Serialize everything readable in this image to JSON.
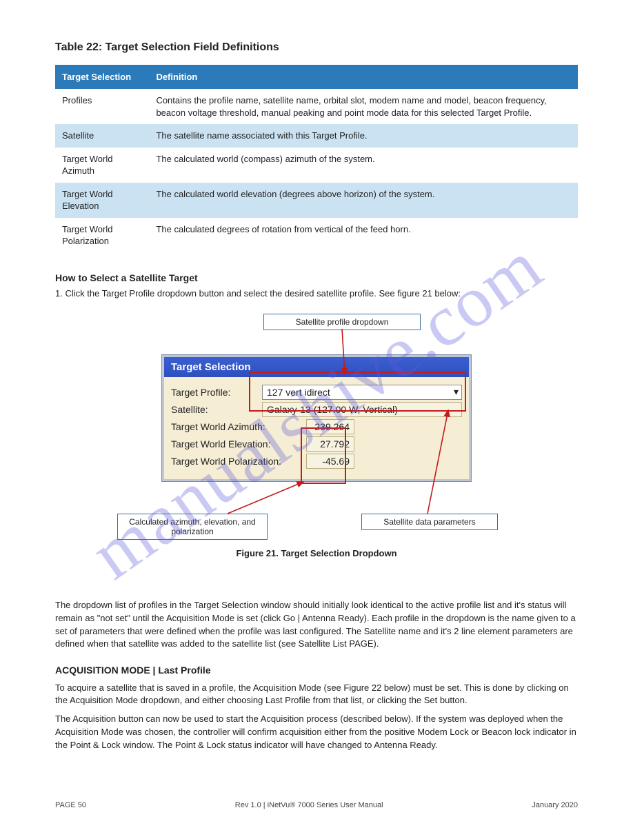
{
  "page": {
    "title": "Table 22: Target Selection Field Definitions",
    "watermark": "manualshive.com"
  },
  "table": {
    "head": {
      "col0": "Target Selection",
      "col1": "Definition"
    },
    "rows": [
      {
        "label": "Profiles",
        "text": "Contains the profile name, satellite name, orbital slot, modem name and model, beacon frequency, beacon voltage threshold, manual peaking and point mode data for this selected Target Profile."
      },
      {
        "label": "Satellite",
        "text": "The satellite name associated with this Target Profile."
      },
      {
        "label": "Target World Azimuth",
        "text": "The calculated world (compass) azimuth of the system."
      },
      {
        "label": "Target World Elevation",
        "text": "The calculated world elevation (degrees above horizon) of the system."
      },
      {
        "label": "Target World Polarization",
        "text": "The calculated degrees of rotation from vertical of the feed horn."
      }
    ]
  },
  "callouts": {
    "heading": "How to Select a Satellite Target",
    "sub": "1. Click the Target Profile dropdown button and select the desired satellite profile. See figure 21 below:",
    "profile_label": "Satellite profile dropdown",
    "calc_label": "Calculated azimuth, elevation, and polarization",
    "sat_label": "Satellite data parameters"
  },
  "panel": {
    "title": "Target Selection",
    "rows": {
      "profile_lbl": "Target Profile:",
      "profile_val": "127 vert idirect",
      "satellite_lbl": "Satellite:",
      "satellite_val": "Galaxy-13 (127.00 W, Vertical)",
      "az_lbl": "Target World Azimuth:",
      "az_val": "239.264",
      "el_lbl": "Target World Elevation:",
      "el_val": "27.792",
      "pol_lbl": "Target World Polarization:",
      "pol_val": "-45.69"
    }
  },
  "figure_caption": "Figure 21. Target Selection Dropdown",
  "section2": {
    "para1": "The dropdown list of profiles in the Target Selection window should initially look identical to the active profile list and it's status will remain as \"not set\" until the Acquisition Mode is set (click Go | Antenna Ready). Each profile in the dropdown is the name given to a set of parameters that were defined when the profile was last configured. The Satellite name and it's 2 line element parameters are defined when that satellite was added to the satellite list (see Satellite List PAGE).",
    "title": "ACQUISITION MODE | Last Profile",
    "para2": "To acquire a satellite that is saved in a profile, the Acquisition Mode (see Figure 22 below) must be set. This is done by clicking on the Acquisition Mode dropdown, and either choosing Last Profile from that list, or clicking the Set button.",
    "para3": "The Acquisition button can now be used to start the Acquisition process (described below). If the system was deployed when the Acquisition Mode was chosen, the controller will confirm acquisition either from the positive Modem Lock or Beacon lock indicator in the Point & Lock window. The Point & Lock status indicator will have changed to Antenna Ready."
  },
  "footer": {
    "left": "PAGE 50",
    "center": "Rev 1.0 | iNetVu® 7000 Series User Manual",
    "right": "January 2020"
  }
}
